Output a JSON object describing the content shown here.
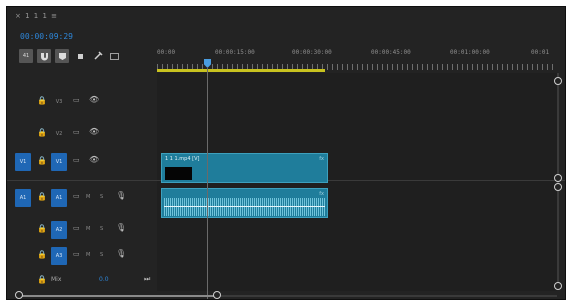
{
  "panel": {
    "title": "× 1 1 1 ≡",
    "timecode": "00:00:09:29"
  },
  "toolbar": {
    "tool1_label": "41",
    "tool2": "nest-icon",
    "tool3": "snap-icon",
    "tool4": "marker-icon",
    "tool5": "wrench-icon",
    "tool6": "captions-icon"
  },
  "ruler": {
    "labels": [
      "00:00",
      "00:00:15:00",
      "00:00:30:00",
      "00:00:45:00",
      "00:01:00:00",
      "00:01"
    ]
  },
  "tracks": {
    "v3": {
      "label": "V3"
    },
    "v2": {
      "label": "V2"
    },
    "v1": {
      "source_patch": "V1",
      "label": "V1"
    },
    "a1": {
      "source_patch": "A1",
      "label": "A1",
      "m": "M",
      "s": "S"
    },
    "a2": {
      "label": "A2",
      "m": "M",
      "s": "S"
    },
    "a3": {
      "label": "A3",
      "m": "M",
      "s": "S"
    },
    "mix": {
      "label": "Mix",
      "value": "0.0"
    }
  },
  "clips": {
    "video": {
      "name": "1 1 1.mp4 [V]",
      "fx": "fx"
    },
    "audio": {
      "fx": "fx"
    }
  },
  "colors": {
    "accent_blue": "#1f67b5",
    "clip_teal": "#1f7d9b",
    "workarea_yellow": "#c8c21f",
    "timecode_blue": "#2e86d8"
  }
}
